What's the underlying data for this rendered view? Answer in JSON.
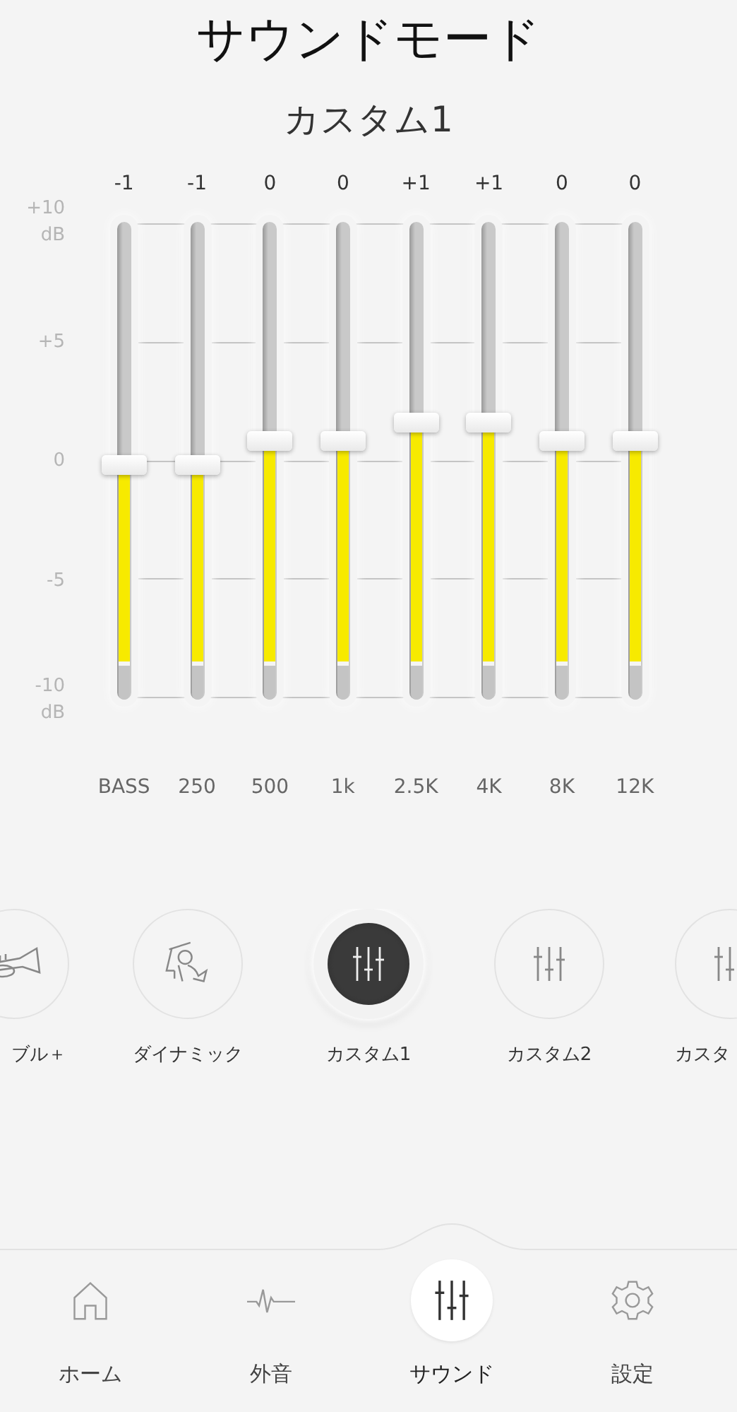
{
  "title": "サウンドモード",
  "preset_name": "カスタム1",
  "eq": {
    "axis_labels": [
      {
        "value": "+10",
        "unit": "dB"
      },
      {
        "value": "+5"
      },
      {
        "value": "0"
      },
      {
        "value": "-5"
      },
      {
        "value": "-10",
        "unit": "dB"
      }
    ],
    "bands": [
      {
        "label": "BASS",
        "reading": "-1",
        "level": 0.49
      },
      {
        "label": "250",
        "reading": "-1",
        "level": 0.49
      },
      {
        "label": "500",
        "reading": "0",
        "level": 0.54
      },
      {
        "label": "1k",
        "reading": "0",
        "level": 0.54
      },
      {
        "label": "2.5K",
        "reading": "+1",
        "level": 0.58
      },
      {
        "label": "4K",
        "reading": "+1",
        "level": 0.58
      },
      {
        "label": "8K",
        "reading": "0",
        "level": 0.54
      },
      {
        "label": "12K",
        "reading": "0",
        "level": 0.54
      }
    ]
  },
  "presets": [
    {
      "label": "ブル＋",
      "kind": "trumpet",
      "selected": false
    },
    {
      "label": "ダイナミック",
      "kind": "conductor",
      "selected": false
    },
    {
      "label": "カスタム1",
      "kind": "sliders",
      "selected": true
    },
    {
      "label": "カスタム2",
      "kind": "sliders",
      "selected": false
    },
    {
      "label": "カスタ",
      "kind": "sliders",
      "selected": false
    }
  ],
  "nav": [
    {
      "label": "ホーム",
      "kind": "home",
      "selected": false
    },
    {
      "label": "外音",
      "kind": "pulse",
      "selected": false
    },
    {
      "label": "サウンド",
      "kind": "sliders",
      "selected": true
    },
    {
      "label": "設定",
      "kind": "gear",
      "selected": false
    }
  ]
}
